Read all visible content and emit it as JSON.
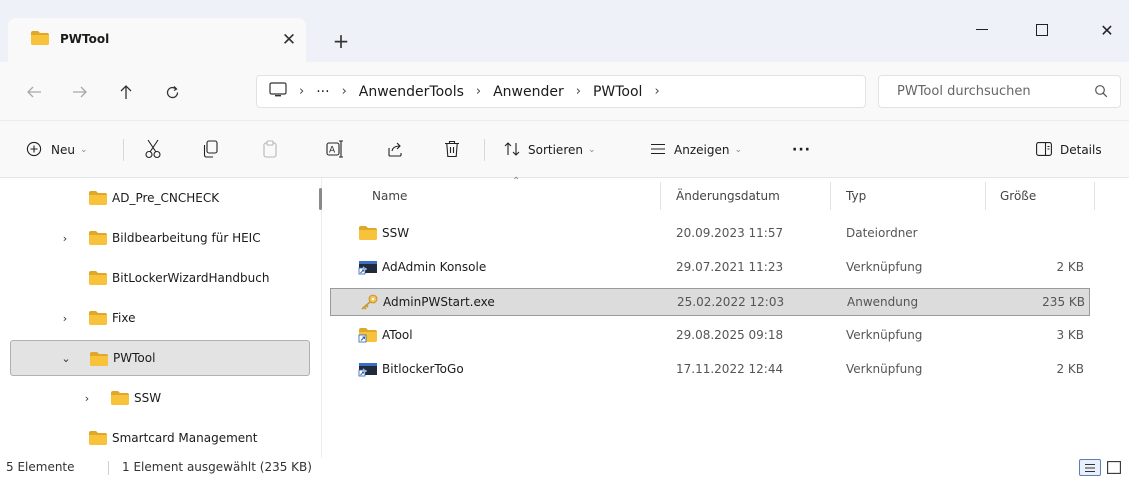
{
  "window": {
    "tab_title": "PWTool",
    "new_tab_label": "+"
  },
  "nav": {
    "breadcrumb": [
      "AnwenderTools",
      "Anwender",
      "PWTool"
    ],
    "overflow_label": "···",
    "search_placeholder": "PWTool durchsuchen"
  },
  "commands": {
    "new_label": "Neu",
    "sort_label": "Sortieren",
    "view_label": "Anzeigen",
    "more_label": "···",
    "details_label": "Details"
  },
  "sidebar": {
    "items": [
      {
        "label": "AD_Pre_CNCHECK",
        "expandable": false,
        "expanded": false,
        "selected": false,
        "level": 1
      },
      {
        "label": "Bildbearbeitung für HEIC",
        "expandable": true,
        "expanded": false,
        "selected": false,
        "level": 1
      },
      {
        "label": "BitLockerWizardHandbuch",
        "expandable": false,
        "expanded": false,
        "selected": false,
        "level": 1
      },
      {
        "label": "Fixe",
        "expandable": true,
        "expanded": false,
        "selected": false,
        "level": 1
      },
      {
        "label": "PWTool",
        "expandable": true,
        "expanded": true,
        "selected": true,
        "level": 1
      },
      {
        "label": "SSW",
        "expandable": true,
        "expanded": false,
        "selected": false,
        "level": 2
      },
      {
        "label": "Smartcard Management",
        "expandable": false,
        "expanded": false,
        "selected": false,
        "level": 1
      }
    ]
  },
  "filelist": {
    "columns": {
      "name": "Name",
      "date": "Änderungsdatum",
      "type": "Typ",
      "size": "Größe"
    },
    "rows": [
      {
        "name": "SSW",
        "date": "20.09.2023 11:57",
        "type": "Dateiordner",
        "size": "",
        "icon": "folder-icon",
        "selected": false
      },
      {
        "name": "AdAdmin Konsole",
        "date": "29.07.2021 11:23",
        "type": "Verknüpfung",
        "size": "2 KB",
        "icon": "console-shortcut-icon",
        "selected": false
      },
      {
        "name": "AdminPWStart.exe",
        "date": "25.02.2022 12:03",
        "type": "Anwendung",
        "size": "235 KB",
        "icon": "key-app-icon",
        "selected": true
      },
      {
        "name": "ATool",
        "date": "29.08.2025 09:18",
        "type": "Verknüpfung",
        "size": "3 KB",
        "icon": "folder-shortcut-icon",
        "selected": false
      },
      {
        "name": "BitlockerToGo",
        "date": "17.11.2022 12:44",
        "type": "Verknüpfung",
        "size": "2 KB",
        "icon": "console-shortcut-icon",
        "selected": false
      }
    ]
  },
  "status": {
    "count": "5 Elemente",
    "selection": "1 Element ausgewählt (235 KB)"
  },
  "colors": {
    "folder_body": "#f8c33b",
    "folder_tab": "#e0a82a",
    "titlebar_bg": "#eef2f8",
    "selection_bg": "#dcdcdc",
    "accent": "#5d7fb5"
  }
}
